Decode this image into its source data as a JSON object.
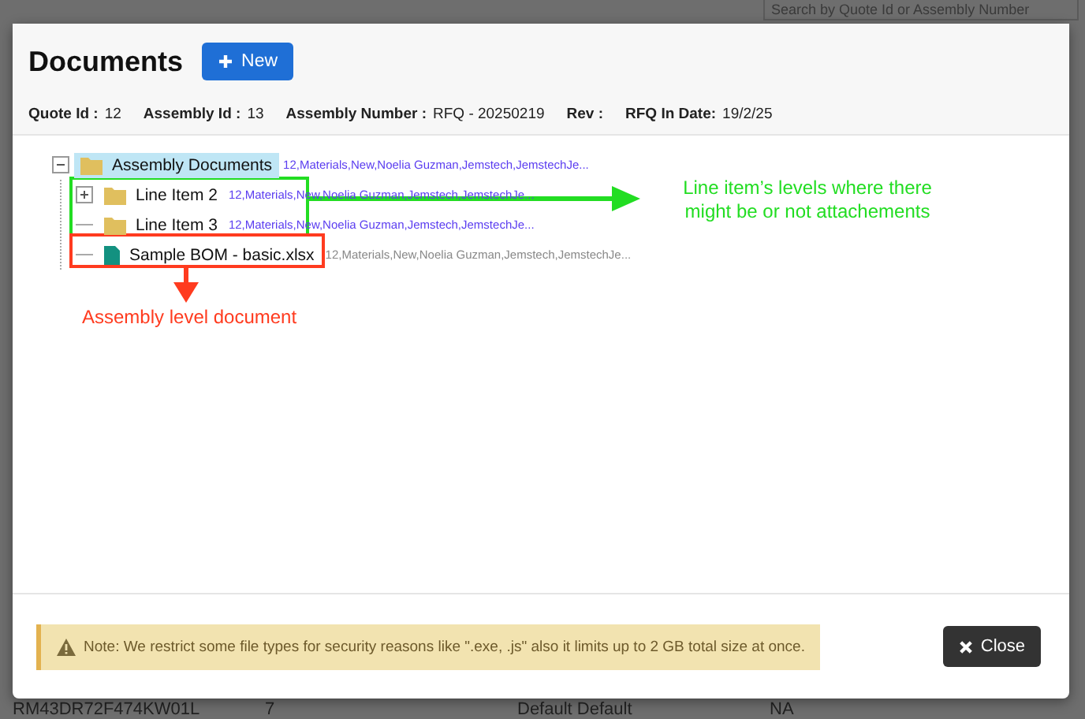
{
  "background": {
    "search": {
      "placeholder": "Search by Quote Id or Assembly Number"
    },
    "row": [
      "RM43DR72F474KW01L",
      "7",
      "Default Default",
      "NA"
    ]
  },
  "dialog": {
    "title": "Documents",
    "new_button": "New",
    "info": [
      {
        "label": "Quote Id :",
        "value": "12"
      },
      {
        "label": "Assembly Id :",
        "value": "13"
      },
      {
        "label": "Assembly Number :",
        "value": "RFQ - 20250219"
      },
      {
        "label": "Rev :"
      },
      {
        "label": "RFQ In Date:",
        "value": "19/2/25"
      }
    ],
    "tree": [
      {
        "kind": "folder",
        "label": "Assembly Documents",
        "meta": "12,Materials,New,Noelia Guzman,Jemstech,JemstechJe...",
        "expanded": true,
        "selected": true,
        "children": [
          {
            "kind": "folder",
            "label": "Line Item 2",
            "meta": "12,Materials,New,Noelia Guzman,Jemstech,JemstechJe...",
            "expanded": false,
            "selected": false
          },
          {
            "kind": "folder",
            "label": "Line Item 3",
            "meta": "12,Materials,New,Noelia Guzman,Jemstech,JemstechJe...",
            "selected": false
          },
          {
            "kind": "file",
            "label": "Sample BOM - basic.xlsx",
            "meta": "12,Materials,New,Noelia Guzman,Jemstech,JemstechJe...",
            "selected": false
          }
        ]
      }
    ],
    "annotations": [
      {
        "text": "Line item’s levels where there might be or not attachements",
        "color": "#22dd22"
      },
      {
        "text": "Assembly level document",
        "color": "#ff3b1f"
      }
    ],
    "note": "Note: We restrict some file types for security reasons like \".exe, .js\" also it limits up to 2 GB total size at once.",
    "close_button": "Close"
  }
}
